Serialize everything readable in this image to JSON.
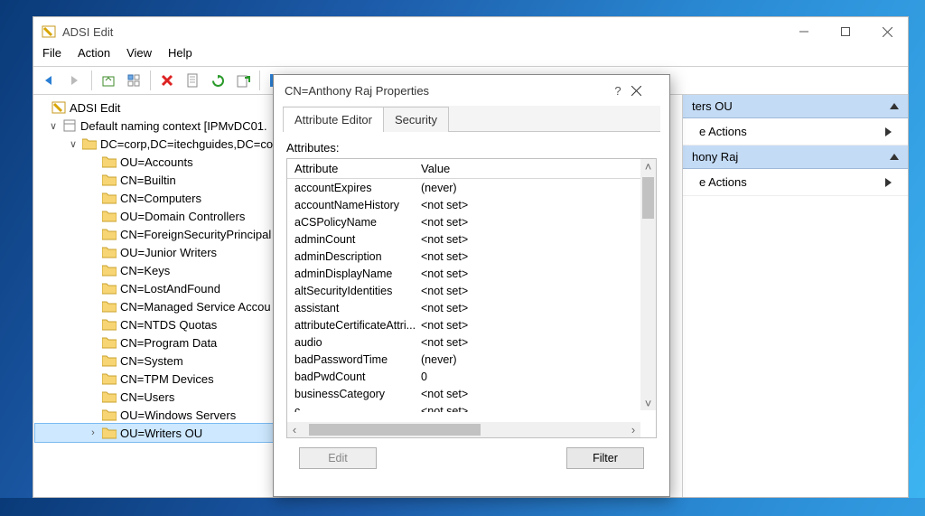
{
  "window_title": "ADSI Edit",
  "menu": {
    "file": "File",
    "action": "Action",
    "view": "View",
    "help": "Help"
  },
  "tree": {
    "root": "ADSI Edit",
    "ctx": "Default naming context [IPMvDC01.",
    "dc": "DC=corp,DC=itechguides,DC=co",
    "items": [
      "OU=Accounts",
      "CN=Builtin",
      "CN=Computers",
      "OU=Domain Controllers",
      "CN=ForeignSecurityPrincipal",
      "OU=Junior Writers",
      "CN=Keys",
      "CN=LostAndFound",
      "CN=Managed Service Accou",
      "CN=NTDS Quotas",
      "CN=Program Data",
      "CN=System",
      "CN=TPM Devices",
      "CN=Users",
      "OU=Windows Servers",
      "OU=Writers OU"
    ]
  },
  "actions": {
    "hdr1": "ters OU",
    "itm1": "e Actions",
    "hdr2": "hony Raj",
    "itm2": "e Actions"
  },
  "dialog": {
    "title": "CN=Anthony Raj Properties",
    "tab_active": "Attribute Editor",
    "tab2": "Security",
    "label_attrs": "Attributes:",
    "col_attr": "Attribute",
    "col_val": "Value",
    "rows": [
      {
        "a": "accountExpires",
        "v": "(never)"
      },
      {
        "a": "accountNameHistory",
        "v": "<not set>"
      },
      {
        "a": "aCSPolicyName",
        "v": "<not set>"
      },
      {
        "a": "adminCount",
        "v": "<not set>"
      },
      {
        "a": "adminDescription",
        "v": "<not set>"
      },
      {
        "a": "adminDisplayName",
        "v": "<not set>"
      },
      {
        "a": "altSecurityIdentities",
        "v": "<not set>"
      },
      {
        "a": "assistant",
        "v": "<not set>"
      },
      {
        "a": "attributeCertificateAttri...",
        "v": "<not set>"
      },
      {
        "a": "audio",
        "v": "<not set>"
      },
      {
        "a": "badPasswordTime",
        "v": "(never)"
      },
      {
        "a": "badPwdCount",
        "v": "0"
      },
      {
        "a": "businessCategory",
        "v": "<not set>"
      },
      {
        "a": "c",
        "v": "<not set>"
      }
    ],
    "btn_edit": "Edit",
    "btn_filter": "Filter"
  }
}
